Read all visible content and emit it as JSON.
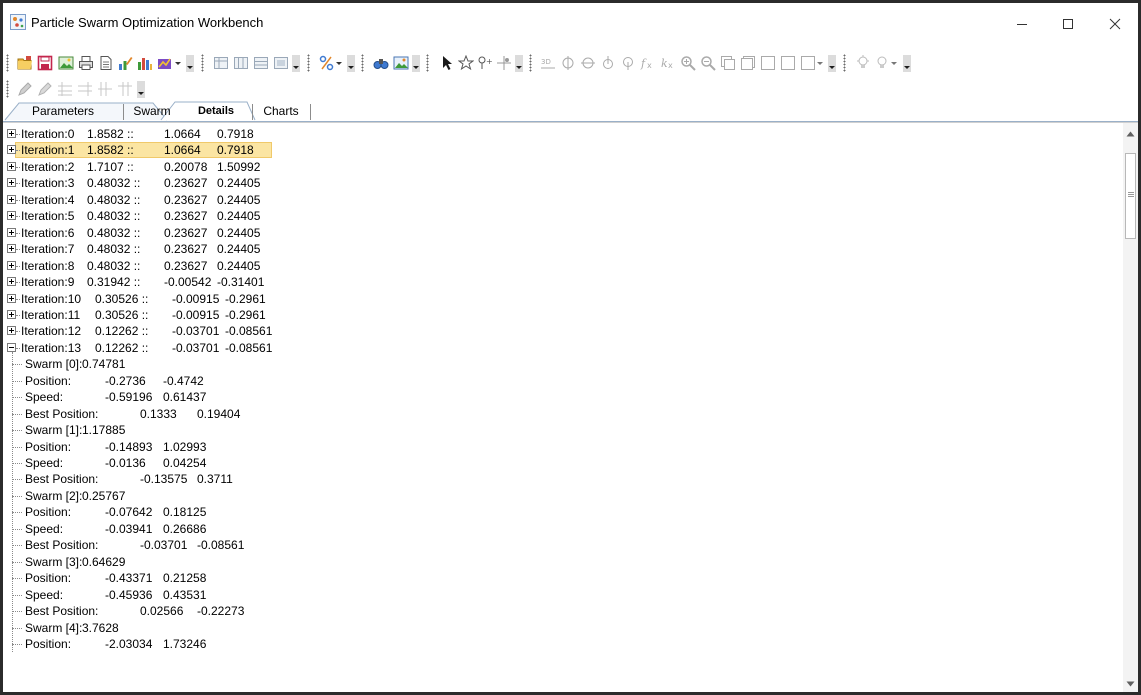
{
  "window": {
    "title": "Particle Swarm Optimization Workbench",
    "controls": [
      "minimize",
      "maximize",
      "close"
    ]
  },
  "tabs": [
    {
      "label": "Parameters",
      "active": false
    },
    {
      "label": "Swarm",
      "active": false
    },
    {
      "label": "Details",
      "active": true
    },
    {
      "label": "Charts",
      "active": false
    }
  ],
  "colors": {
    "selection": "#fbe5a3",
    "selection_border": "#f0c96a"
  },
  "iterations": [
    {
      "label": "Iteration:0",
      "value": "1.8582 ::",
      "x": "1.0664",
      "y": "0.7918",
      "expanded": false
    },
    {
      "label": "Iteration:1",
      "value": "1.8582 ::",
      "x": "1.0664",
      "y": "0.7918",
      "expanded": false,
      "selected": true
    },
    {
      "label": "Iteration:2",
      "value": "1.7107 ::",
      "x": "0.20078",
      "y": "1.50992",
      "expanded": false
    },
    {
      "label": "Iteration:3",
      "value": "0.48032 ::",
      "x": "0.23627",
      "y": "0.24405",
      "expanded": false
    },
    {
      "label": "Iteration:4",
      "value": "0.48032 ::",
      "x": "0.23627",
      "y": "0.24405",
      "expanded": false
    },
    {
      "label": "Iteration:5",
      "value": "0.48032 ::",
      "x": "0.23627",
      "y": "0.24405",
      "expanded": false
    },
    {
      "label": "Iteration:6",
      "value": "0.48032 ::",
      "x": "0.23627",
      "y": "0.24405",
      "expanded": false
    },
    {
      "label": "Iteration:7",
      "value": "0.48032 ::",
      "x": "0.23627",
      "y": "0.24405",
      "expanded": false
    },
    {
      "label": "Iteration:8",
      "value": "0.48032 ::",
      "x": "0.23627",
      "y": "0.24405",
      "expanded": false
    },
    {
      "label": "Iteration:9",
      "value": "0.31942 ::",
      "x": "-0.00542",
      "y": "-0.31401",
      "expanded": false
    },
    {
      "label": "Iteration:10",
      "value": "0.30526 ::",
      "x": "-0.00915",
      "y": "-0.2961",
      "expanded": false
    },
    {
      "label": "Iteration:11",
      "value": "0.30526 ::",
      "x": "-0.00915",
      "y": "-0.2961",
      "expanded": false
    },
    {
      "label": "Iteration:12",
      "value": "0.12262 ::",
      "x": "-0.03701",
      "y": "-0.08561",
      "expanded": false
    },
    {
      "label": "Iteration:13",
      "value": "0.12262 ::",
      "x": "-0.03701",
      "y": "-0.08561",
      "expanded": true
    }
  ],
  "details": [
    {
      "label": "Swarm [0]:",
      "a": "0.74781",
      "b": ""
    },
    {
      "label": "Position:",
      "a": "-0.2736",
      "b": "-0.4742"
    },
    {
      "label": "Speed:",
      "a": "-0.59196",
      "b": "0.61437"
    },
    {
      "label": "Best Position:",
      "a": "0.1333",
      "b": "0.19404"
    },
    {
      "label": "Swarm [1]:",
      "a": "1.17885",
      "b": ""
    },
    {
      "label": "Position:",
      "a": "-0.14893",
      "b": "1.02993"
    },
    {
      "label": "Speed:",
      "a": "-0.0136",
      "b": "0.04254"
    },
    {
      "label": "Best Position:",
      "a": "-0.13575",
      "b": "0.3711"
    },
    {
      "label": "Swarm [2]:",
      "a": "0.25767",
      "b": ""
    },
    {
      "label": "Position:",
      "a": "-0.07642",
      "b": "0.18125"
    },
    {
      "label": "Speed:",
      "a": "-0.03941",
      "b": "0.26686"
    },
    {
      "label": "Best Position:",
      "a": "-0.03701",
      "b": "-0.08561"
    },
    {
      "label": "Swarm [3]:",
      "a": "0.64629",
      "b": ""
    },
    {
      "label": "Position:",
      "a": "-0.43371",
      "b": "0.21258"
    },
    {
      "label": "Speed:",
      "a": "-0.45936",
      "b": "0.43531"
    },
    {
      "label": "Best Position:",
      "a": "0.02566",
      "b": "-0.22273"
    },
    {
      "label": "Swarm [4]:",
      "a": "3.7628",
      "b": ""
    },
    {
      "label": "Position:",
      "a": "-2.03034",
      "b": "1.73246"
    }
  ]
}
